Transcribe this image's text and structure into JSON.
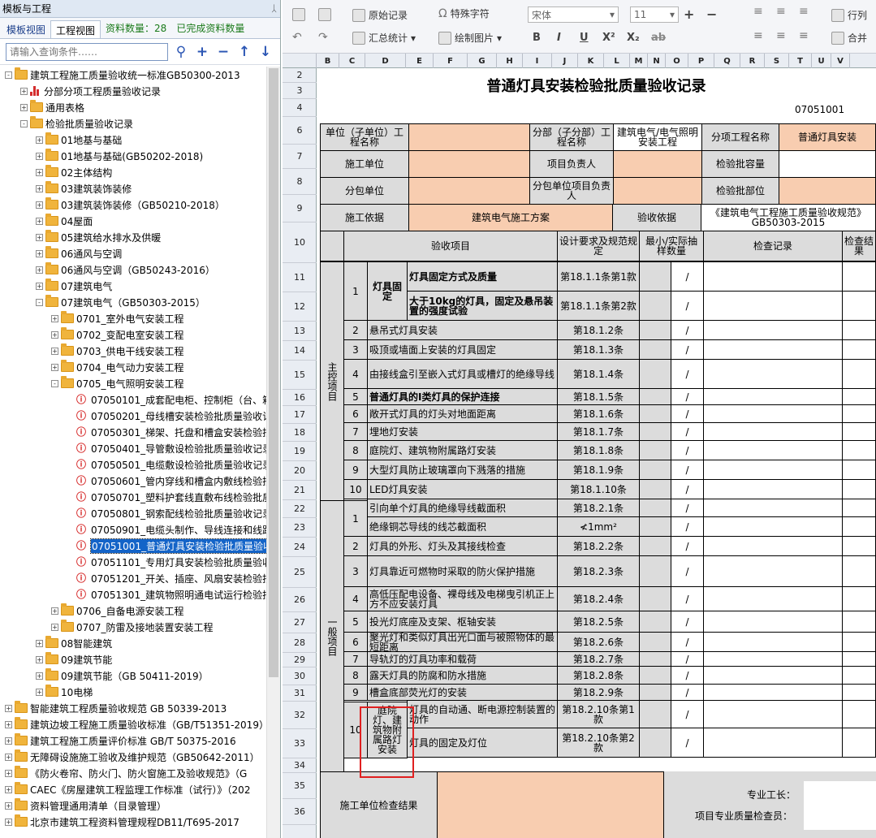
{
  "left_panel": {
    "title": "模板与工程",
    "pin": "ᛸ",
    "tabs": [
      "模板视图",
      "工程视图"
    ],
    "stat_count": "资料数量：28",
    "stat_done": "已完成资料数量",
    "search_placeholder": "请输入查询条件……",
    "tree": [
      {
        "level": 0,
        "exp": "-",
        "icon": "folder",
        "label": "建筑工程施工质量验收统一标准GB50300-2013"
      },
      {
        "level": 1,
        "exp": "+",
        "icon": "chart",
        "label": "分部分项工程质量验收记录"
      },
      {
        "level": 1,
        "exp": "+",
        "icon": "folder",
        "label": "通用表格"
      },
      {
        "level": 1,
        "exp": "-",
        "icon": "folder",
        "label": "检验批质量验收记录"
      },
      {
        "level": 2,
        "exp": "+",
        "icon": "folder",
        "label": "01地基与基础"
      },
      {
        "level": 2,
        "exp": "+",
        "icon": "folder",
        "label": "01地基与基础(GB50202-2018)"
      },
      {
        "level": 2,
        "exp": "+",
        "icon": "folder",
        "label": "02主体结构"
      },
      {
        "level": 2,
        "exp": "+",
        "icon": "folder",
        "label": "03建筑装饰装修"
      },
      {
        "level": 2,
        "exp": "+",
        "icon": "folder",
        "label": "03建筑装饰装修（GB50210-2018）"
      },
      {
        "level": 2,
        "exp": "+",
        "icon": "folder",
        "label": "04屋面"
      },
      {
        "level": 2,
        "exp": "+",
        "icon": "folder",
        "label": "05建筑给水排水及供暖"
      },
      {
        "level": 2,
        "exp": "+",
        "icon": "folder",
        "label": "06通风与空调"
      },
      {
        "level": 2,
        "exp": "+",
        "icon": "folder",
        "label": "06通风与空调（GB50243-2016）"
      },
      {
        "level": 2,
        "exp": "+",
        "icon": "folder",
        "label": "07建筑电气"
      },
      {
        "level": 2,
        "exp": "-",
        "icon": "folder",
        "label": "07建筑电气（GB50303-2015）"
      },
      {
        "level": 3,
        "exp": "+",
        "icon": "folder",
        "label": "0701_室外电气安装工程"
      },
      {
        "level": 3,
        "exp": "+",
        "icon": "folder",
        "label": "0702_变配电室安装工程"
      },
      {
        "level": 3,
        "exp": "+",
        "icon": "folder",
        "label": "0703_供电干线安装工程"
      },
      {
        "level": 3,
        "exp": "+",
        "icon": "folder",
        "label": "0704_电气动力安装工程"
      },
      {
        "level": 3,
        "exp": "-",
        "icon": "folder",
        "label": "0705_电气照明安装工程"
      },
      {
        "level": 4,
        "exp": "",
        "icon": "doc",
        "label": "07050101_成套配电柜、控制柜（台、箱"
      },
      {
        "level": 4,
        "exp": "",
        "icon": "doc",
        "label": "07050201_母线槽安装检验批质量验收记"
      },
      {
        "level": 4,
        "exp": "",
        "icon": "doc",
        "label": "07050301_梯架、托盘和槽盒安装检验批"
      },
      {
        "level": 4,
        "exp": "",
        "icon": "doc",
        "label": "07050401_导管敷设检验批质量验收记录"
      },
      {
        "level": 4,
        "exp": "",
        "icon": "doc",
        "label": "07050501_电缆敷设检验批质量验收记录"
      },
      {
        "level": 4,
        "exp": "",
        "icon": "doc",
        "label": "07050601_管内穿线和槽盒内敷线检验批"
      },
      {
        "level": 4,
        "exp": "",
        "icon": "doc",
        "label": "07050701_塑料护套线直敷布线检验批质"
      },
      {
        "level": 4,
        "exp": "",
        "icon": "doc",
        "label": "07050801_钢索配线检验批质量验收记录"
      },
      {
        "level": 4,
        "exp": "",
        "icon": "doc",
        "label": "07050901_电缆头制作、导线连接和线路"
      },
      {
        "level": 4,
        "exp": "",
        "icon": "doc",
        "label": "07051001_普通灯具安装检验批质量验收",
        "selected": true
      },
      {
        "level": 4,
        "exp": "",
        "icon": "doc",
        "label": "07051101_专用灯具安装检验批质量验收"
      },
      {
        "level": 4,
        "exp": "",
        "icon": "doc",
        "label": "07051201_开关、插座、风扇安装检验批"
      },
      {
        "level": 4,
        "exp": "",
        "icon": "doc",
        "label": "07051301_建筑物照明通电试运行检验批"
      },
      {
        "level": 3,
        "exp": "+",
        "icon": "folder",
        "label": "0706_自备电源安装工程"
      },
      {
        "level": 3,
        "exp": "+",
        "icon": "folder",
        "label": "0707_防雷及接地装置安装工程"
      },
      {
        "level": 2,
        "exp": "+",
        "icon": "folder",
        "label": "08智能建筑"
      },
      {
        "level": 2,
        "exp": "+",
        "icon": "folder",
        "label": "09建筑节能"
      },
      {
        "level": 2,
        "exp": "+",
        "icon": "folder",
        "label": "09建筑节能（GB 50411-2019）"
      },
      {
        "level": 2,
        "exp": "+",
        "icon": "folder",
        "label": "10电梯"
      },
      {
        "level": 0,
        "exp": "+",
        "icon": "folder",
        "label": "智能建筑工程质量验收规范 GB 50339-2013"
      },
      {
        "level": 0,
        "exp": "+",
        "icon": "folder",
        "label": "建筑边坡工程施工质量验收标准（GB/T51351-2019）"
      },
      {
        "level": 0,
        "exp": "+",
        "icon": "folder",
        "label": "建筑工程施工质量评价标准 GB/T 50375-2016"
      },
      {
        "level": 0,
        "exp": "+",
        "icon": "folder",
        "label": "无障碍设施施工验收及维护规范（GB50642-2011）"
      },
      {
        "level": 0,
        "exp": "+",
        "icon": "folder",
        "label": "《防火卷帘、防火门、防火窗施工及验收规范》（G"
      },
      {
        "level": 0,
        "exp": "+",
        "icon": "folder",
        "label": "CAEC《房屋建筑工程监理工作标准（试行）》（202"
      },
      {
        "level": 0,
        "exp": "+",
        "icon": "folder",
        "label": "资料管理通用清单（目录管理）"
      },
      {
        "level": 0,
        "exp": "+",
        "icon": "folder",
        "label": "北京市建筑工程资料管理规程DB11/T695-2017"
      }
    ]
  },
  "toolbar": {
    "orig_record": "原始记录",
    "special_char": "特殊字符",
    "font_name": "宋体",
    "font_size": "11",
    "summary": "汇总统计",
    "draw_image": "绘制图片",
    "row_col": "行列",
    "merge": "合并",
    "bold": "B",
    "italic": "I",
    "underline": "U",
    "sup": "X²",
    "sub": "X₂",
    "strike": "ab",
    "plus": "+",
    "minus": "−"
  },
  "columns": [
    "B",
    "C",
    "D",
    "E",
    "F",
    "G",
    "H",
    "I",
    "J",
    "K",
    "L",
    "M",
    "N",
    "O",
    "P",
    "Q",
    "R",
    "S",
    "T",
    "U",
    "V"
  ],
  "rows": [
    "2",
    "3",
    "4",
    "6",
    "7",
    "8",
    "9",
    "10",
    "11",
    "12",
    "13",
    "14",
    "15",
    "16",
    "17",
    "18",
    "19",
    "20",
    "21",
    "22",
    "23",
    "24",
    "25",
    "26",
    "27",
    "28",
    "29",
    "30",
    "31",
    "32",
    "33",
    "34",
    "35",
    "36"
  ],
  "sheet": {
    "title": "普通灯具安装检验批质量验收记录",
    "code": "07051001",
    "h_unit": "单位（子单位）工程名称",
    "h_division": "分部（子分部）工程名称",
    "v_division": "建筑电气/电气照明安装工程",
    "h_sub": "分项工程名称",
    "v_sub": "普通灯具安装",
    "h_contractor": "施工单位",
    "h_pm": "项目负责人",
    "h_capacity": "检验批容量",
    "h_subcontractor": "分包单位",
    "h_sub_pm": "分包单位项目负责人",
    "h_location": "检验批部位",
    "h_basis": "施工依据",
    "v_basis": "建筑电气施工方案",
    "h_acceptance": "验收依据",
    "v_acceptance": "《建筑电气工程施工质量验收规范》GB50303-2015",
    "col_item": "验收项目",
    "col_design": "设计要求及规范规定",
    "col_sample": "最小/实际抽样数量",
    "col_check": "检查记录",
    "col_result": "检查结果",
    "main_label": "主控项目",
    "general_label": "一般项目",
    "item1_group": "灯具固定",
    "main_items": [
      {
        "no": "1",
        "text": "灯具固定方式及质量",
        "spec": "第18.1.1条第1款",
        "bold": true
      },
      {
        "no": "",
        "text": "大于10kg的灯具，固定及悬吊装置的强度试验",
        "spec": "第18.1.1条第2款",
        "bold": true
      },
      {
        "no": "2",
        "text": "悬吊式灯具安装",
        "spec": "第18.1.2条"
      },
      {
        "no": "3",
        "text": "吸顶或墙面上安装的灯具固定",
        "spec": "第18.1.3条"
      },
      {
        "no": "4",
        "text": "由接线盒引至嵌入式灯具或槽灯的绝缘导线",
        "spec": "第18.1.4条"
      },
      {
        "no": "5",
        "text": "普通灯具的I类灯具的保护连接",
        "spec": "第18.1.5条",
        "bold": true
      },
      {
        "no": "6",
        "text": "敞开式灯具的灯头对地面距离",
        "spec": "第18.1.6条"
      },
      {
        "no": "7",
        "text": "埋地灯安装",
        "spec": "第18.1.7条"
      },
      {
        "no": "8",
        "text": "庭院灯、建筑物附属路灯安装",
        "spec": "第18.1.8条"
      },
      {
        "no": "9",
        "text": "大型灯具防止玻璃罩向下溅落的措施",
        "spec": "第18.1.9条"
      },
      {
        "no": "10",
        "text": "LED灯具安装",
        "spec": "第18.1.10条"
      }
    ],
    "general_items": [
      {
        "no": "1",
        "text": "引向单个灯具的绝缘导线截面积",
        "spec": "第18.2.1条"
      },
      {
        "no": "",
        "text": "绝缘铜芯导线的线芯截面积",
        "spec": "≮1mm²"
      },
      {
        "no": "2",
        "text": "灯具的外形、灯头及其接线检查",
        "spec": "第18.2.2条"
      },
      {
        "no": "3",
        "text": "灯具靠近可燃物时采取的防火保护措施",
        "spec": "第18.2.3条"
      },
      {
        "no": "4",
        "text": "高低压配电设备、裸母线及电梯曳引机正上方不应安装灯具",
        "spec": "第18.2.4条"
      },
      {
        "no": "5",
        "text": "投光灯底座及支架、枢轴安装",
        "spec": "第18.2.5条"
      },
      {
        "no": "6",
        "text": "聚光灯和类似灯具出光口面与被照物体的最短距离",
        "spec": "第18.2.6条"
      },
      {
        "no": "7",
        "text": "导轨灯的灯具功率和载荷",
        "spec": "第18.2.7条"
      },
      {
        "no": "8",
        "text": "露天灯具的防腐和防水措施",
        "spec": "第18.2.8条"
      },
      {
        "no": "9",
        "text": "槽盒底部荧光灯的安装",
        "spec": "第18.2.9条"
      },
      {
        "no": "10",
        "text": "灯具的自动通、断电源控制装置的动作",
        "spec": "第18.2.10条第1款"
      },
      {
        "no": "",
        "text": "灯具的固定及灯位",
        "spec": "第18.2.10条第2款"
      }
    ],
    "item10_group": "庭院灯、建筑物附属路灯安装",
    "slash": "/",
    "foot_label": "施工单位检查结果",
    "foreman": "专业工长：",
    "inspector": "项目专业质量检查员："
  }
}
